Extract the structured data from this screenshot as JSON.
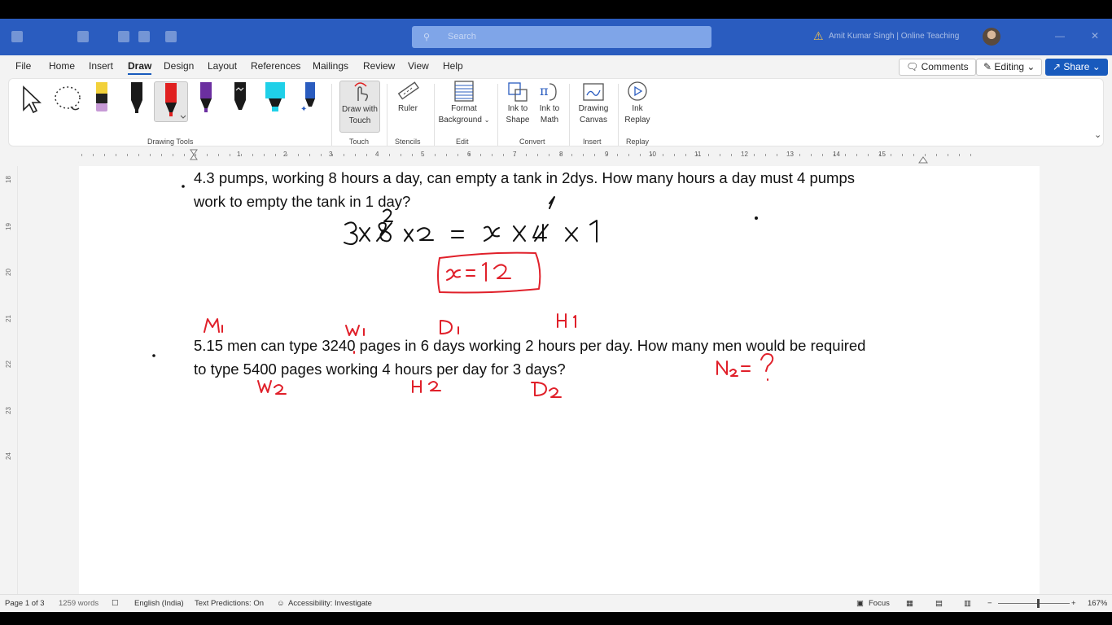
{
  "titlebar": {
    "search_placeholder": "Search",
    "user_text": "Amit Kumar Singh | Online Teaching"
  },
  "ribbon": {
    "tabs": [
      "File",
      "Home",
      "Insert",
      "Draw",
      "Design",
      "Layout",
      "References",
      "Mailings",
      "Review",
      "View",
      "Help"
    ],
    "active_tab": "Draw",
    "comments_label": "Comments",
    "editing_label": "Editing",
    "share_label": "Share",
    "groups": {
      "drawing_tools": "Drawing Tools",
      "touch": "Touch",
      "stencils": "Stencils",
      "edit": "Edit",
      "convert": "Convert",
      "insert": "Insert",
      "replay": "Replay"
    },
    "buttons": {
      "draw_with_touch_1": "Draw with",
      "draw_with_touch_2": "Touch",
      "ruler": "Ruler",
      "format_bg_1": "Format",
      "format_bg_2": "Background",
      "ink_shape_1": "Ink to",
      "ink_shape_2": "Shape",
      "ink_math_1": "Ink to",
      "ink_math_2": "Math",
      "drawing_canvas_1": "Drawing",
      "drawing_canvas_2": "Canvas",
      "ink_replay_1": "Ink",
      "ink_replay_2": "Replay"
    },
    "pen_colors": [
      "#1a1a1a",
      "#1a1a1a",
      "#e02020",
      "#6b2fa0",
      "#1a1a1a",
      "#1fd0e8",
      "#1a1a1a"
    ]
  },
  "ruler": {
    "numbers": [
      "1",
      "2",
      "3",
      "4",
      "5",
      "6",
      "7",
      "8",
      "9",
      "10",
      "11",
      "12",
      "13",
      "14",
      "15"
    ],
    "vertical": [
      "18",
      "19",
      "20",
      "21",
      "22",
      "23",
      "24"
    ]
  },
  "document": {
    "q4_line1": "4.3 pumps, working 8 hours a day, can empty a tank in 2dys. How many hours a day must 4 pumps",
    "q4_line2": "work to empty the tank in 1 day?",
    "q5_line1": "5.15 men can type 3240 pages in 6 days working 2 hours per day. How many men would be required",
    "q5_line2": "to type 5400 pages working 4 hours per day for 3 days?",
    "ink_color_black": "#111111",
    "ink_color_red": "#e0202a"
  },
  "status": {
    "page": "Page 1 of 3",
    "words": "1259 words",
    "language": "English (India)",
    "text_predictions": "Text Predictions: On",
    "accessibility": "Accessibility: Investigate",
    "focus": "Focus",
    "zoom": "167%"
  }
}
